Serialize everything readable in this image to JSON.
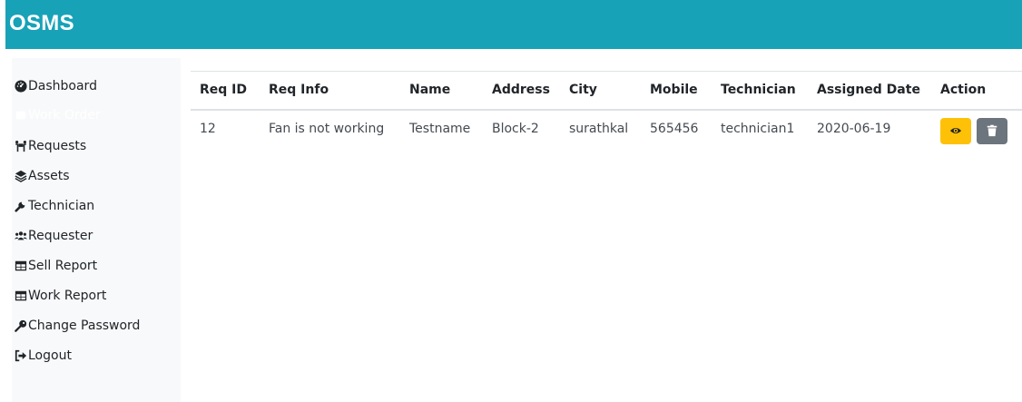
{
  "app": {
    "title": "OSMS"
  },
  "sidebar": {
    "items": [
      {
        "label": "Dashboard",
        "icon": "tachometer-icon"
      },
      {
        "label": "Work Order",
        "icon": "fab-icon",
        "active": true
      },
      {
        "label": "Requests",
        "icon": "people-carry-icon"
      },
      {
        "label": "Assets",
        "icon": "layer-group-icon"
      },
      {
        "label": "Technician",
        "icon": "wrench-icon"
      },
      {
        "label": "Requester",
        "icon": "users-icon"
      },
      {
        "label": "Sell Report",
        "icon": "table-icon"
      },
      {
        "label": "Work Report",
        "icon": "table-icon"
      },
      {
        "label": "Change Password",
        "icon": "key-icon"
      },
      {
        "label": "Logout",
        "icon": "sign-out-icon"
      }
    ]
  },
  "table": {
    "headers": [
      "Req ID",
      "Req Info",
      "Name",
      "Address",
      "City",
      "Mobile",
      "Technician",
      "Assigned Date",
      "Action"
    ],
    "rows": [
      {
        "req_id": "12",
        "req_info": "Fan is not working",
        "name": "Testname",
        "address": "Block-2",
        "city": "surathkal",
        "mobile": "565456",
        "technician": "technician1",
        "assigned_date": "2020-06-19"
      }
    ]
  },
  "colors": {
    "brand": "#17a2b8",
    "warning": "#ffc107",
    "secondary": "#6c757d",
    "sidebar": "#f8f9fa"
  }
}
